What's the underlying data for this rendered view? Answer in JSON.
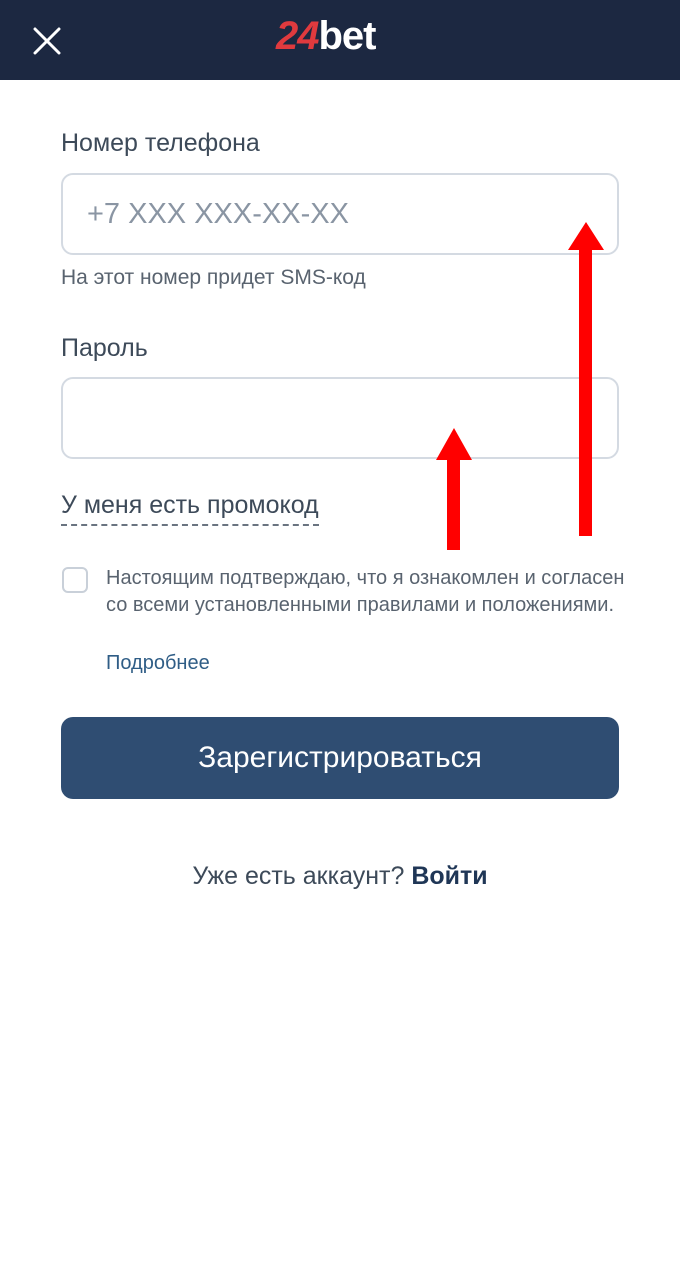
{
  "header": {
    "close_icon": "close-icon",
    "logo_number": "24",
    "logo_word": "bet",
    "background_color": "#1c2841",
    "logo_accent_color": "#e03a3e"
  },
  "form": {
    "phone_label": "Номер телефона",
    "phone_placeholder": "+7 XXX XXX-XX-XX",
    "phone_value": "",
    "phone_hint": "На этот номер придет SMS-код",
    "password_label": "Пароль",
    "password_value": "",
    "promo_link": "У меня есть промокод",
    "terms_text": "Настоящим подтверждаю, что я ознакомлен и согласен со всеми установленными правилами и положениями.",
    "terms_checked": false,
    "more_link": "Подробнее",
    "register_button": "Зарегистрироваться",
    "register_button_color": "#2f4d72"
  },
  "footer": {
    "have_account_text": "Уже есть аккаунт?",
    "login_link": "Войти"
  },
  "annotations": {
    "arrow_color": "#ff0000",
    "arrow_icons": [
      "up-arrow-annotation",
      "up-arrow-annotation"
    ]
  }
}
